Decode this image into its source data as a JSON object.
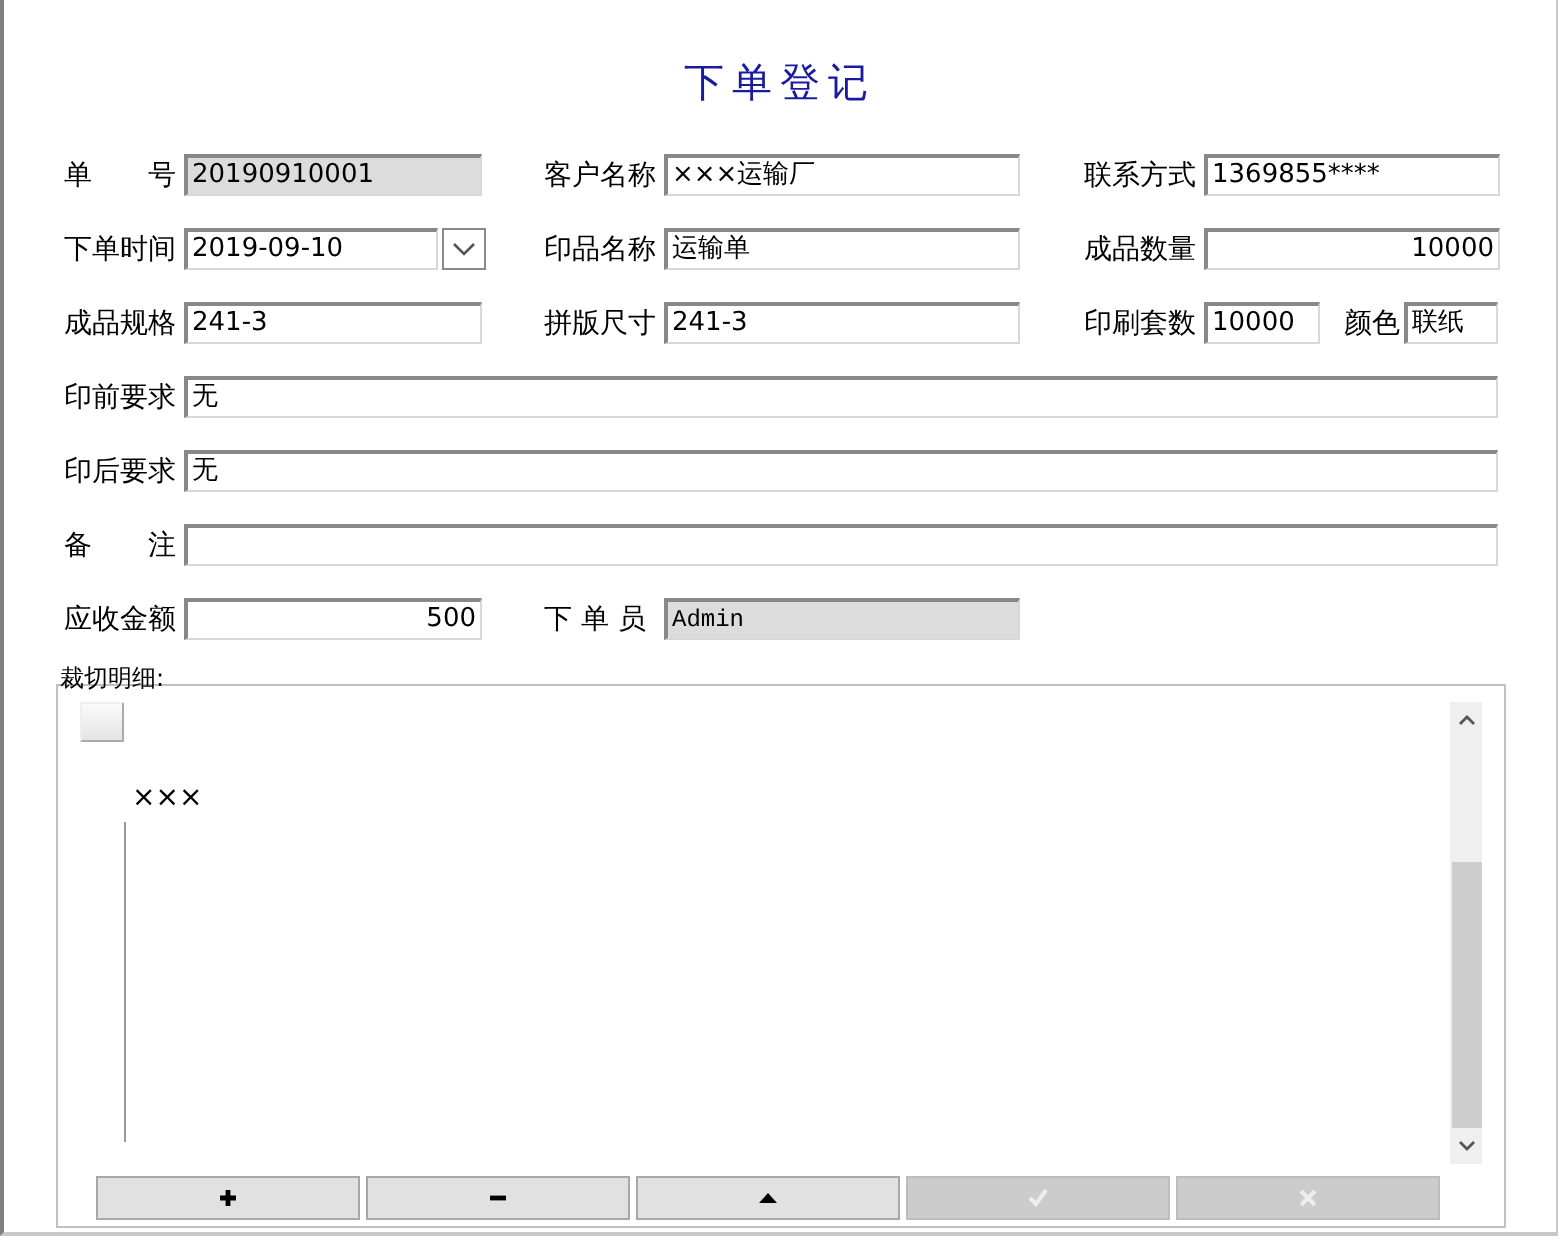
{
  "title": "下单登记",
  "rows": [
    [
      {
        "label": "单　　号",
        "value": "20190910001",
        "kind": "text",
        "disabled": true
      },
      {
        "label": "客户名称",
        "value": "×××运输厂",
        "kind": "text",
        "disabled": false
      },
      {
        "label": "联系方式",
        "value": "1369855****",
        "kind": "text",
        "disabled": false
      }
    ],
    [
      {
        "label": "下单时间",
        "value": "2019-09-10",
        "kind": "date",
        "disabled": false
      },
      {
        "label": "印品名称",
        "value": "运输单",
        "kind": "text",
        "disabled": false
      },
      {
        "label": "成品数量",
        "value": "10000",
        "kind": "number",
        "disabled": false
      }
    ],
    [
      {
        "label": "成品规格",
        "value": "241-3",
        "kind": "text",
        "disabled": false
      },
      {
        "label": "拼版尺寸",
        "value": "241-3",
        "kind": "text",
        "disabled": false
      },
      {
        "label": "印刷套数",
        "value": "10000",
        "kind": "text",
        "disabled": false
      },
      {
        "label": "颜色",
        "value": "联纸",
        "kind": "text",
        "disabled": false
      }
    ],
    [
      {
        "label": "印前要求",
        "value": "无",
        "kind": "text",
        "disabled": false
      }
    ],
    [
      {
        "label": "印后要求",
        "value": "无",
        "kind": "text",
        "disabled": false
      }
    ],
    [
      {
        "label": "备　　注",
        "kind": "text",
        "disabled": false
      }
    ],
    [
      {
        "label": "应收金额",
        "value": "500",
        "kind": "number",
        "disabled": false
      },
      {
        "label": "下 单 员",
        "value": "Admin",
        "kind": "mono",
        "disabled": true
      }
    ]
  ],
  "detail": {
    "title": "裁切明细:",
    "tree": [
      {
        "label": "×××"
      }
    ],
    "buttons": [
      {
        "kind": "plus",
        "disabled": false
      },
      {
        "kind": "minus",
        "disabled": false
      },
      {
        "kind": "up",
        "disabled": false
      },
      {
        "kind": "check",
        "disabled": true
      },
      {
        "kind": "cross",
        "disabled": true
      }
    ]
  }
}
